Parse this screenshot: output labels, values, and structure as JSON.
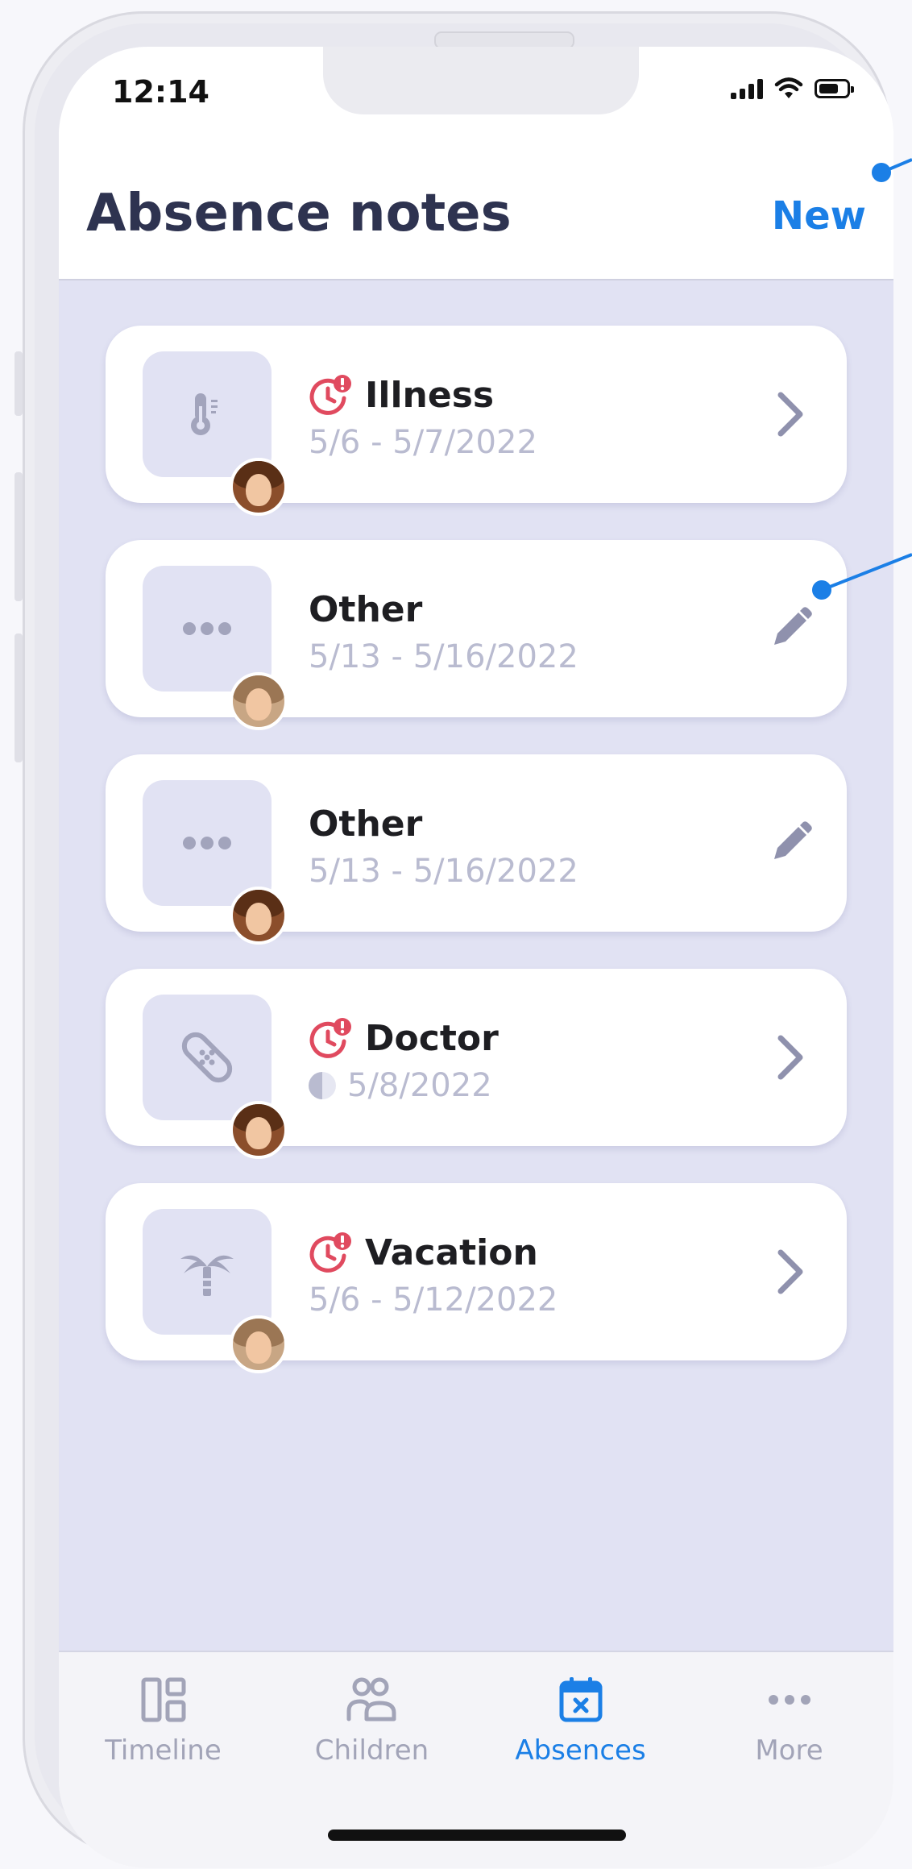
{
  "status": {
    "time": "12:14"
  },
  "header": {
    "title": "Absence notes",
    "new_label": "New"
  },
  "absences": [
    {
      "type": "Illness",
      "dates": "5/6 - 5/7/2022",
      "icon": "thermometer-icon",
      "pending": true,
      "half_day": false,
      "action": "chevron-right-icon",
      "avatar": "boy"
    },
    {
      "type": "Other",
      "dates": "5/13 - 5/16/2022",
      "icon": "ellipsis-icon",
      "pending": false,
      "half_day": false,
      "action": "edit-pencil-icon",
      "avatar": "girl"
    },
    {
      "type": "Other",
      "dates": "5/13 - 5/16/2022",
      "icon": "ellipsis-icon",
      "pending": false,
      "half_day": false,
      "action": "edit-pencil-icon",
      "avatar": "boy"
    },
    {
      "type": "Doctor",
      "dates": "5/8/2022",
      "icon": "bandage-icon",
      "pending": true,
      "half_day": true,
      "action": "chevron-right-icon",
      "avatar": "boy"
    },
    {
      "type": "Vacation",
      "dates": "5/6 - 5/12/2022",
      "icon": "palm-tree-icon",
      "pending": true,
      "half_day": false,
      "action": "chevron-right-icon",
      "avatar": "girl"
    }
  ],
  "tabs": [
    {
      "label": "Timeline",
      "icon": "dashboard-icon",
      "active": false
    },
    {
      "label": "Children",
      "icon": "children-icon",
      "active": false
    },
    {
      "label": "Absences",
      "icon": "calendar-x-icon",
      "active": true
    },
    {
      "label": "More",
      "icon": "ellipsis-icon",
      "active": false
    }
  ],
  "colors": {
    "accent": "#1b7fe6",
    "pending": "#e04a5f",
    "title": "#2e3350",
    "muted": "#b9bbd0",
    "background": "#e1e2f3"
  }
}
